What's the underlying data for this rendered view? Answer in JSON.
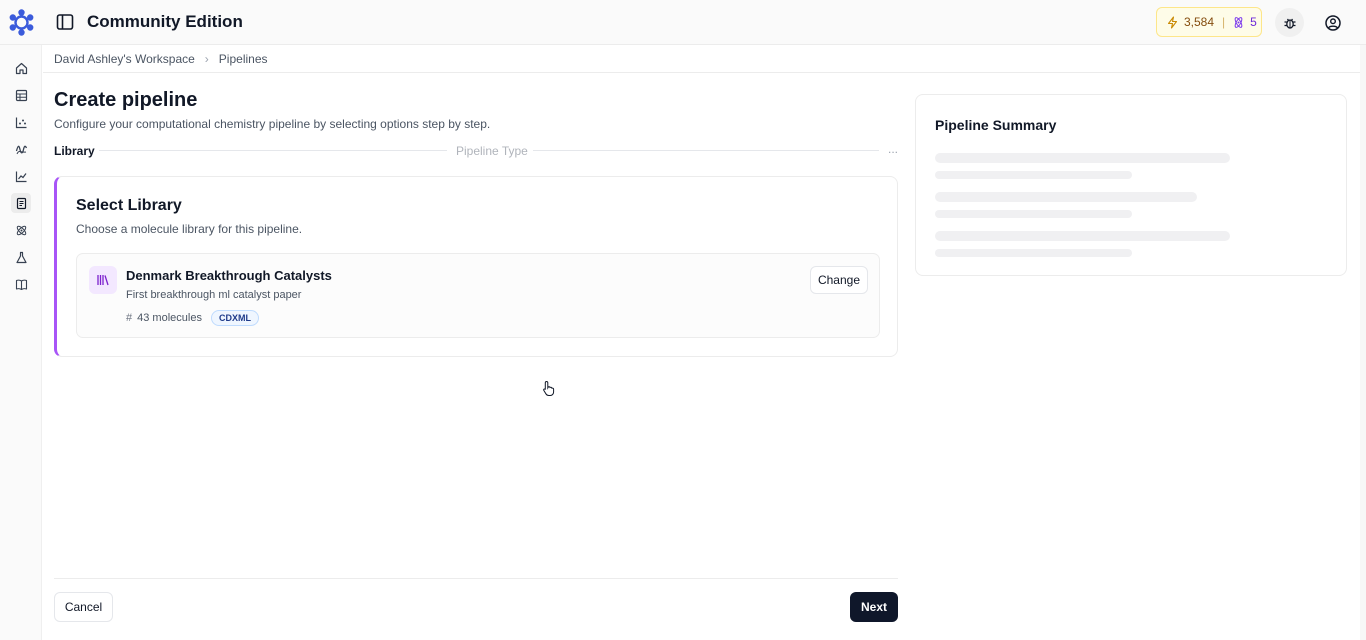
{
  "topbar": {
    "title": "Community Edition",
    "credits": {
      "amount": "3,584",
      "separator": "|",
      "count": "5"
    },
    "icons": {
      "logo": "flower-logo-icon",
      "sidebar_toggle": "sidebar-toggle-icon",
      "bolt": "bolt-icon",
      "atom": "atom-icon",
      "bug": "bug-icon",
      "user": "user-circle-icon"
    },
    "colors": {
      "logo": "#3b5bdb",
      "credits_bg": "#fefce8",
      "credits_border": "#fde68a"
    }
  },
  "rail": {
    "items": [
      {
        "name": "home-icon"
      },
      {
        "name": "table-icon"
      },
      {
        "name": "scatter-chart-icon"
      },
      {
        "name": "waveform-icon"
      },
      {
        "name": "line-chart-icon"
      },
      {
        "name": "document-icon",
        "active": true
      },
      {
        "name": "molecule-icon"
      },
      {
        "name": "flask-icon"
      },
      {
        "name": "book-icon"
      }
    ]
  },
  "breadcrumb": {
    "workspace": "David Ashley's Workspace",
    "chevron": "›",
    "current": "Pipelines"
  },
  "page": {
    "title": "Create pipeline",
    "subtitle": "Configure your computational chemistry pipeline by selecting options step by step."
  },
  "stepper": {
    "step1": "Library",
    "step2": "Pipeline Type",
    "more": "..."
  },
  "library_card": {
    "title": "Select Library",
    "subtitle": "Choose a molecule library for this pipeline.",
    "accent": "#a855f7",
    "selected": {
      "name": "Denmark Breakthrough Catalysts",
      "description": "First breakthrough ml catalyst paper",
      "hash": "#",
      "molecules": "43 molecules",
      "format": "CDXML",
      "change_label": "Change",
      "icon": "library-icon"
    }
  },
  "footer": {
    "cancel_label": "Cancel",
    "next_label": "Next"
  },
  "summary": {
    "title": "Pipeline Summary"
  }
}
